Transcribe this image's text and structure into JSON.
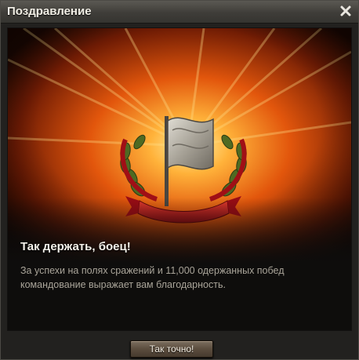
{
  "window": {
    "title": "Поздравление"
  },
  "icons": {
    "close": "close-icon",
    "emblem": "banner-flag-laurel-emblem-icon"
  },
  "banner": {
    "heading": "Так держать, боец!",
    "message": "За успехи на полях сражений и 11,000 одержанных побед командование выражает вам благодарность."
  },
  "footer": {
    "ok_label": "Так точно!"
  },
  "colors": {
    "background": "#22211f",
    "accent_orange": "#ff8a1e",
    "ribbon_red": "#b8141e"
  }
}
